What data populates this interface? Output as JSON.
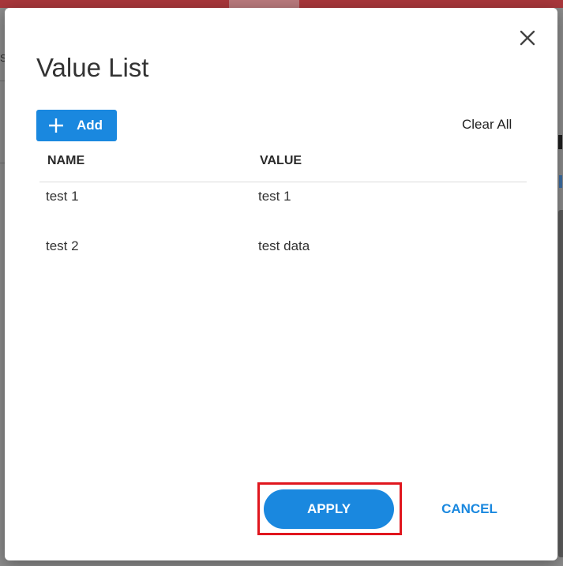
{
  "dialog": {
    "title": "Value List",
    "close_icon": "close-icon"
  },
  "toolbar": {
    "add_label": "Add",
    "add_icon": "plus-icon",
    "clear_all_label": "Clear All"
  },
  "table": {
    "columns": [
      "NAME",
      "VALUE"
    ],
    "rows": [
      {
        "name": "test 1",
        "value": "test 1"
      },
      {
        "name": "test 2",
        "value": "test data"
      }
    ]
  },
  "footer": {
    "apply_label": "APPLY",
    "cancel_label": "CANCEL"
  },
  "colors": {
    "primary": "#1a88df",
    "highlight": "#e0161e",
    "text": "#333333"
  },
  "background": {
    "left_fragment": "Si"
  }
}
